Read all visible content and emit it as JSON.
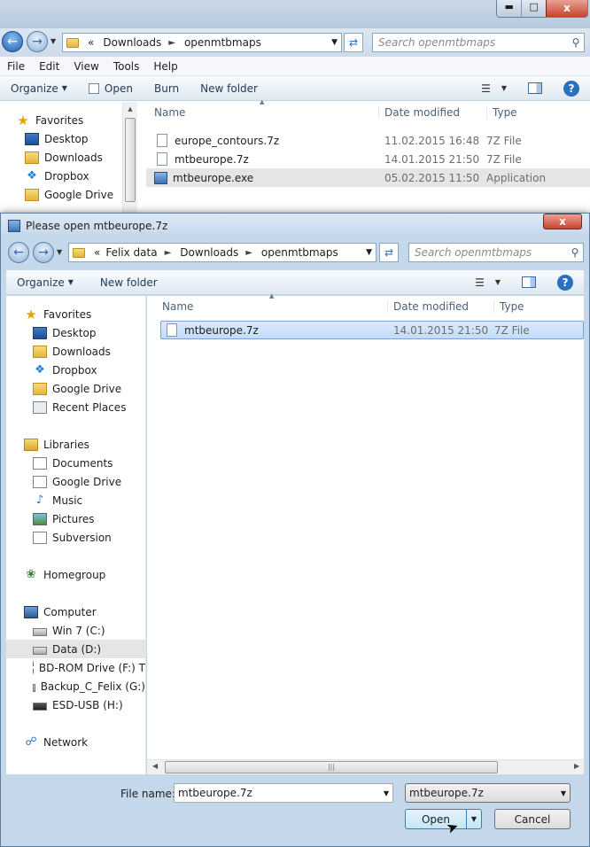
{
  "background_window": {
    "address": {
      "prefix": "«",
      "crumbs": [
        "Downloads",
        "openmtbmaps"
      ]
    },
    "search_placeholder": "Search openmtbmaps",
    "menu": [
      "File",
      "Edit",
      "View",
      "Tools",
      "Help"
    ],
    "toolbar": {
      "organize": "Organize",
      "open": "Open",
      "burn": "Burn",
      "new_folder": "New folder"
    },
    "nav": [
      {
        "label": "Favorites",
        "icon": "star-icon"
      },
      {
        "label": "Desktop",
        "icon": "desktop-icon"
      },
      {
        "label": "Downloads",
        "icon": "downloads-folder-icon"
      },
      {
        "label": "Dropbox",
        "icon": "dropbox-icon"
      },
      {
        "label": "Google Drive",
        "icon": "google-drive-folder-icon"
      }
    ],
    "columns": {
      "name": "Name",
      "date": "Date modified",
      "type": "Type"
    },
    "files": [
      {
        "name": "europe_contours.7z",
        "date": "11.02.2015 16:48",
        "type": "7Z File",
        "icon": "file-icon"
      },
      {
        "name": "mtbeurope.7z",
        "date": "14.01.2015 21:50",
        "type": "7Z File",
        "icon": "file-icon"
      },
      {
        "name": "mtbeurope.exe",
        "date": "05.02.2015 11:50",
        "type": "Application",
        "icon": "app-icon"
      }
    ]
  },
  "dialog": {
    "title": "Please open mtbeurope.7z",
    "close_label": "x",
    "address": {
      "prefix": "«",
      "crumbs": [
        "Felix data",
        "Downloads",
        "openmtbmaps"
      ]
    },
    "search_placeholder": "Search openmtbmaps",
    "toolbar": {
      "organize": "Organize",
      "new_folder": "New folder"
    },
    "nav_groups": [
      {
        "header": "Favorites",
        "icon": "star-icon",
        "items": [
          {
            "label": "Desktop",
            "icon": "desktop-icon"
          },
          {
            "label": "Downloads",
            "icon": "downloads-folder-icon"
          },
          {
            "label": "Dropbox",
            "icon": "dropbox-icon"
          },
          {
            "label": "Google Drive",
            "icon": "google-drive-folder-icon"
          },
          {
            "label": "Recent Places",
            "icon": "recent-places-icon"
          }
        ]
      },
      {
        "header": "Libraries",
        "icon": "libraries-icon",
        "items": [
          {
            "label": "Documents",
            "icon": "documents-icon"
          },
          {
            "label": "Google Drive",
            "icon": "documents-icon"
          },
          {
            "label": "Music",
            "icon": "music-icon"
          },
          {
            "label": "Pictures",
            "icon": "pictures-icon"
          },
          {
            "label": "Subversion",
            "icon": "documents-icon"
          }
        ]
      },
      {
        "header": "Homegroup",
        "icon": "homegroup-icon",
        "items": []
      },
      {
        "header": "Computer",
        "icon": "computer-icon",
        "items": [
          {
            "label": "Win 7 (C:)",
            "icon": "windows-drive-icon"
          },
          {
            "label": "Data (D:)",
            "icon": "drive-icon"
          },
          {
            "label": "BD-ROM Drive (F:) T",
            "icon": "cd-drive-icon"
          },
          {
            "label": "Backup_C_Felix (G:)",
            "icon": "drive-icon"
          },
          {
            "label": "ESD-USB (H:)",
            "icon": "usb-drive-icon"
          }
        ]
      },
      {
        "header": "Network",
        "icon": "network-icon",
        "items": []
      }
    ],
    "columns": {
      "name": "Name",
      "date": "Date modified",
      "type": "Type"
    },
    "files": [
      {
        "name": "mtbeurope.7z",
        "date": "14.01.2015 21:50",
        "type": "7Z File"
      }
    ],
    "file_name_label": "File name:",
    "file_name_value": "mtbeurope.7z",
    "filter_value": "mtbeurope.7z",
    "open_label": "Open",
    "cancel_label": "Cancel"
  }
}
